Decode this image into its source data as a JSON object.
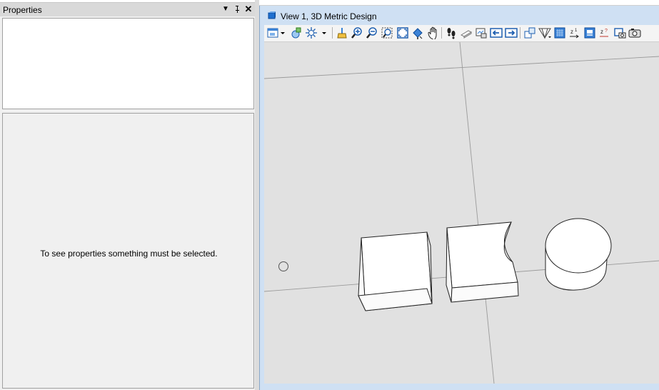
{
  "properties_panel": {
    "title": "Properties",
    "dropdown_glyph": "▼",
    "pin_glyph": "ф",
    "close_glyph": "✕",
    "empty_message": "To see properties something must be selected."
  },
  "view_window": {
    "title": "View 1, 3D Metric Design",
    "toolbar_icons": [
      "view-attributes-icon",
      "view-dropdown-icon",
      "display-style-icon",
      "lighting-icon",
      "lighting-dropdown-icon",
      "update-view-icon",
      "zoom-in-icon",
      "zoom-out-icon",
      "window-area-icon",
      "fit-view-icon",
      "rotate-view-icon",
      "pan-view-icon",
      "walk-icon",
      "camera-icon",
      "view-previous-icon",
      "view-next-icon",
      "copy-view-icon",
      "clip-volume-icon",
      "saved-view-icon",
      "clip-mask-icon",
      "change-view-perspective-icon",
      "toggle-view-icon",
      "snapshot-icon"
    ]
  },
  "colors": {
    "panel_bg": "#f0f0f0",
    "view_frame": "#cfe0f3",
    "viewport_bg": "#e1e1e1",
    "solid_fill": "#ffffff",
    "edge": "#222222"
  }
}
